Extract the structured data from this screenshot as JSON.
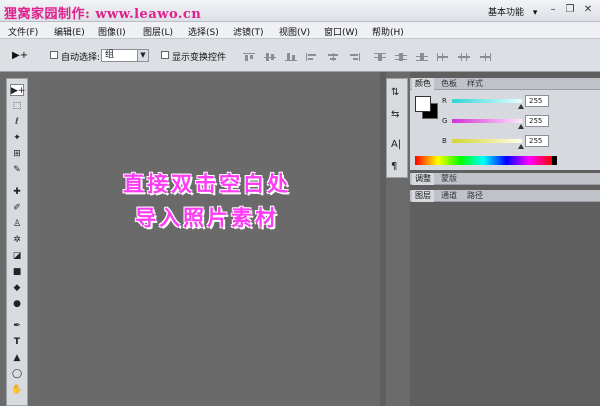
{
  "window": {
    "title": "狸窝家园制作: www.leawo.cn",
    "workspace_label": "基本功能",
    "workspace_arrow": "▾",
    "min_glyph": "–",
    "restore_glyph": "❐",
    "close_glyph": "✕"
  },
  "menu": {
    "items": [
      "文件(F)",
      "编辑(E)",
      "图像(I)",
      "图层(L)",
      "选择(S)",
      "滤镜(T)",
      "视图(V)",
      "窗口(W)",
      "帮助(H)"
    ]
  },
  "options": {
    "tool_glyph": "▶+",
    "auto_select_label": "自动选择:",
    "auto_select_value": "组",
    "show_transform_label": "显示变换控件"
  },
  "toolbox": {
    "glyphs": [
      "▶+",
      "⬚",
      "ℓ",
      "✦",
      "⊞",
      "✎",
      "✚",
      "✐",
      "♙",
      "✲",
      "◪",
      "■",
      "◆",
      "●",
      "✒",
      "T",
      "▲",
      "◯",
      "✋"
    ]
  },
  "canvas": {
    "hint_line1": "直接双击空白处",
    "hint_line2": "导入照片素材"
  },
  "panel_icons": [
    "⇅",
    "⇆",
    "A|",
    "¶"
  ],
  "color_panel": {
    "tabs": [
      "颜色",
      "色板",
      "样式"
    ],
    "channels": [
      {
        "label": "R",
        "value": "255",
        "color": "#2fd4d4"
      },
      {
        "label": "G",
        "value": "255",
        "color": "#d42fd4"
      },
      {
        "label": "B",
        "value": "255",
        "color": "#d4d42f"
      }
    ]
  },
  "adjust_panel": {
    "tabs": [
      "调整",
      "蒙版"
    ]
  },
  "layers_panel": {
    "tabs": [
      "图层",
      "通道",
      "路径"
    ]
  }
}
